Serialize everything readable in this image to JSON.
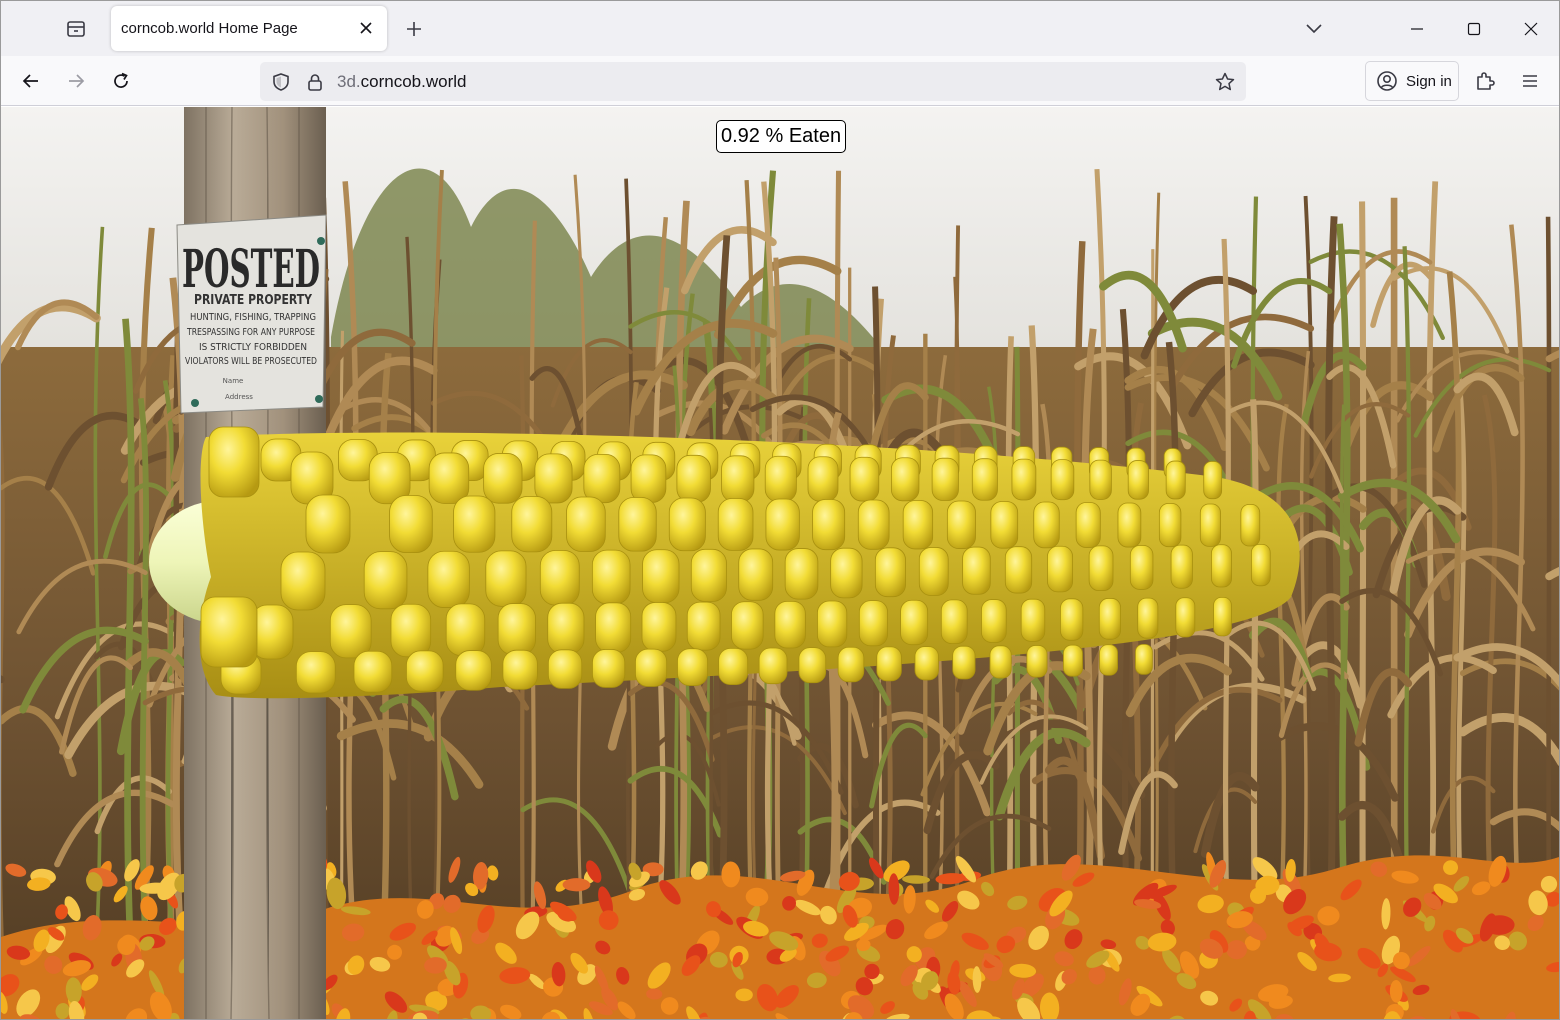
{
  "browser": {
    "tab": {
      "title": "corncob.world Home Page"
    },
    "address_bar": {
      "url_prefix": "3d.",
      "url_domain": "corncob.world"
    },
    "account": {
      "sign_in_label": "Sign in"
    },
    "icons": {
      "tab_list": "tab-list-icon",
      "tab_close": "close-icon",
      "new_tab": "plus-icon",
      "list_all_tabs": "chevron-down-icon",
      "minimize": "minimize-icon",
      "maximize": "maximize-icon",
      "close_window": "close-icon",
      "back": "arrow-left-icon",
      "forward": "arrow-right-icon",
      "reload": "reload-icon",
      "tracking_protection": "shield-icon",
      "secure": "lock-icon",
      "bookmark": "star-icon",
      "account": "account-icon",
      "extensions": "puzzle-icon",
      "menu": "hamburger-icon"
    }
  },
  "page": {
    "counter": {
      "value": "0.92",
      "suffix": "% Eaten"
    },
    "sign": {
      "heading": "POSTED",
      "line1": "PRIVATE PROPERTY",
      "line2": "HUNTING, FISHING, TRAPPING",
      "line3": "TRESPASSING FOR ANY PURPOSE",
      "line4": "IS STRICTLY FORBIDDEN",
      "line5": "VIOLATORS WILL BE PROSECUTED",
      "line6": "Name",
      "line7": "Address"
    },
    "colors": {
      "kernel": "#f2dc35",
      "cob": "#eef5b8",
      "sky": "#ecebe8",
      "stalk": "#9a7a4a",
      "pole": "#a99a86",
      "foliage": "#e07a1c"
    }
  }
}
